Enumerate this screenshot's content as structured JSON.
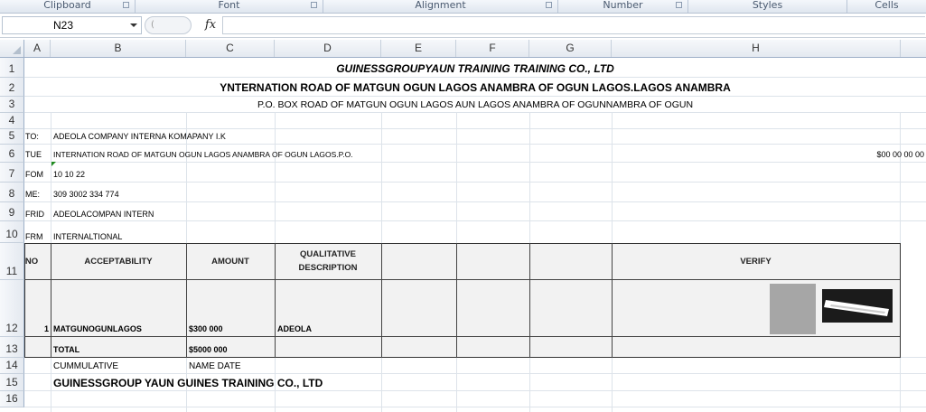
{
  "ribbon": {
    "groups": [
      "Clipboard",
      "Font",
      "Alignment",
      "Number",
      "Styles",
      "Cells"
    ]
  },
  "formula_bar": {
    "name_box": "N23",
    "fx_label": "fx",
    "formula": ""
  },
  "columns": [
    "A",
    "B",
    "C",
    "D",
    "E",
    "F",
    "G",
    "H"
  ],
  "rows": [
    "1",
    "2",
    "3",
    "4",
    "5",
    "6",
    "7",
    "8",
    "9",
    "10",
    "11",
    "12",
    "13",
    "14",
    "15",
    "16"
  ],
  "header": {
    "company": "GUINESSGROUPYAUN TRAINING TRAINING CO., LTD",
    "address1": "YNTERNATION ROAD OF MATGUN OGUN LAGOS ANAMBRA OF OGUN LAGOS.LAGOS ANAMBRA",
    "address2": "P.O. BOX ROAD OF MATGUN OGUN LAGOS AUN LAGOS ANAMBRA OF OGUNNAMBRA OF OGUN"
  },
  "info": [
    {
      "label": "TO:",
      "value": "ADEOLA COMPANY INTERNA KOMAPANY I.K"
    },
    {
      "label": "TUE",
      "value": "INTERNATION ROAD OF MATGUN OGUN LAGOS ANAMBRA OF OGUN LAGOS.P.O.",
      "right": "$00 00 00 00"
    },
    {
      "label": "FOM",
      "value": "10 10 22"
    },
    {
      "label": "ME:",
      "value": "309 3002 334 774"
    },
    {
      "label": "FRID",
      "value": "ADEOLACOMPAN INTERN"
    },
    {
      "label": "FRM",
      "value": "INTERNALTIONAL"
    }
  ],
  "table": {
    "headers": {
      "no": "NO",
      "acceptability": "ACCEPTABILITY",
      "amount": "AMOUNT",
      "qualitative_line1": "QUALITATIVE",
      "qualitative_line2": "DESCRIPTION",
      "verify": "VERIFY"
    },
    "row": {
      "no": "1",
      "acceptability": "MATGUNOGUNLAGOS",
      "amount": "$300 000",
      "description": "ADEOLA"
    },
    "total": {
      "label": "TOTAL",
      "amount": "$5000 000"
    }
  },
  "footer": {
    "cumulative": "CUMMULATIVE",
    "name_date": "NAME DATE",
    "company": "GUINESSGROUP YAUN GUINES TRAINING CO., LTD"
  },
  "colors": {
    "ribbon_bg": "#dfe6ef",
    "header_bg": "#e4e9f0",
    "gridline": "#dde3ea",
    "table_shade": "#f2f2f2",
    "signature_grey": "#a6a6a6",
    "signature_black": "#1b1b1b"
  }
}
